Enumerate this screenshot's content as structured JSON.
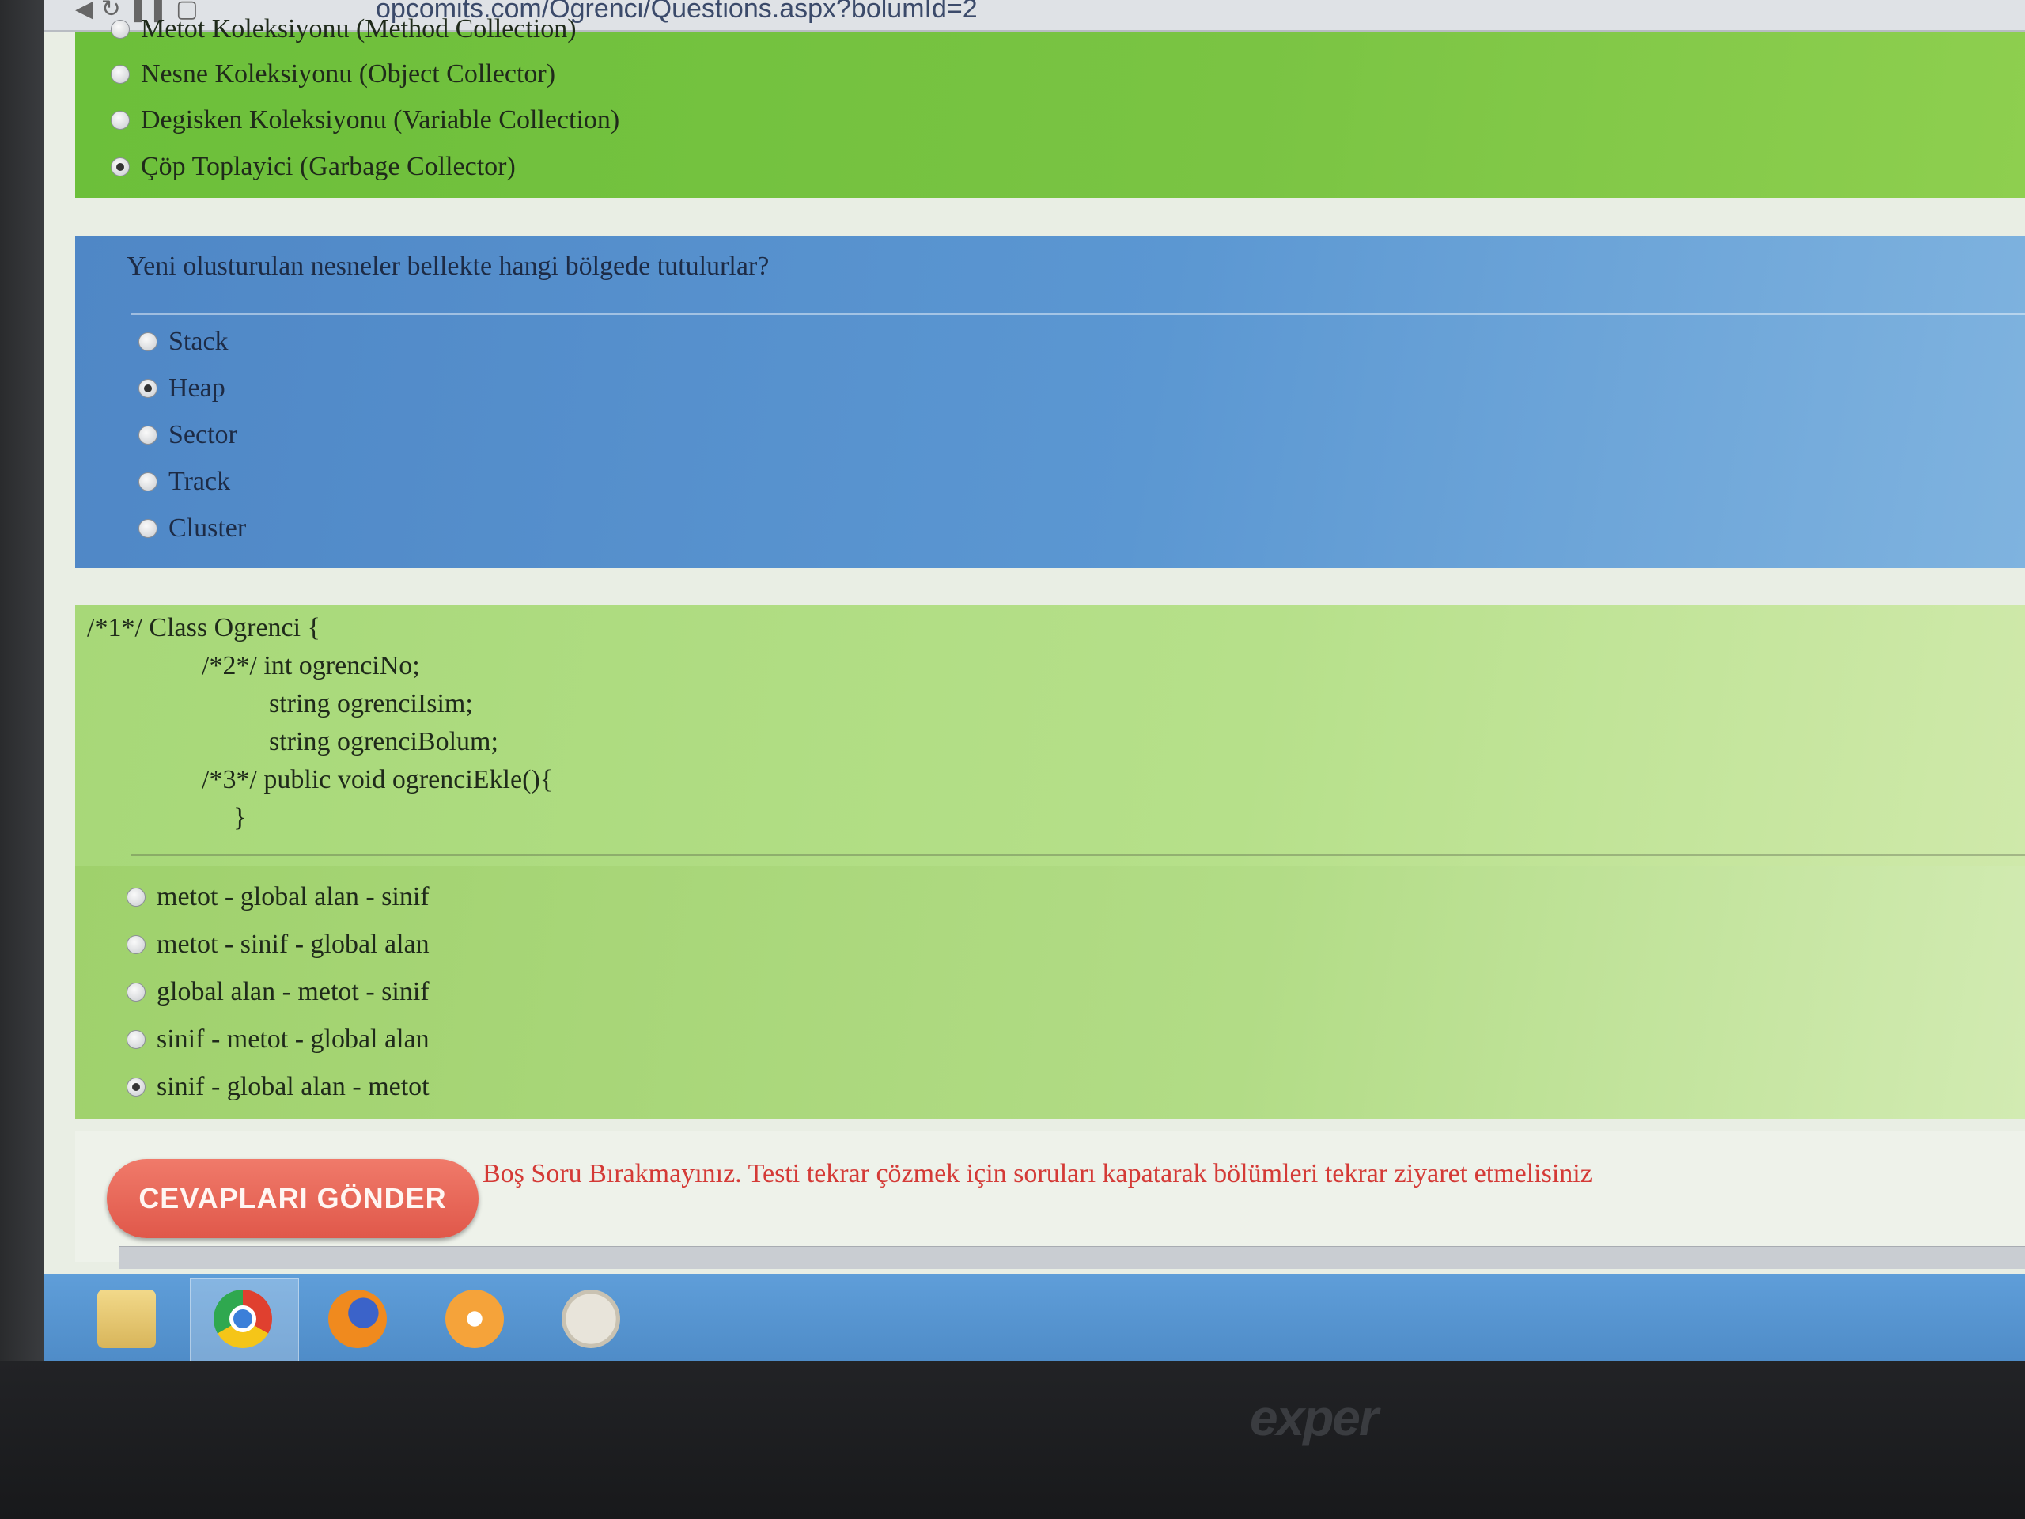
{
  "browser": {
    "url": "opcomits.com/Ogrenci/Questions.aspx?bolumId=2"
  },
  "question1": {
    "options": [
      {
        "label": "Metot Koleksiyonu (Method Collection)",
        "checked": false
      },
      {
        "label": "Nesne Koleksiyonu (Object Collector)",
        "checked": false
      },
      {
        "label": "Degisken Koleksiyonu (Variable Collection)",
        "checked": false
      },
      {
        "label": "Çöp Toplayici (Garbage Collector)",
        "checked": true
      }
    ]
  },
  "question2": {
    "text": "Yeni olusturulan nesneler bellekte hangi bölgede tutulurlar?",
    "options": [
      {
        "label": "Stack",
        "checked": false
      },
      {
        "label": "Heap",
        "checked": true
      },
      {
        "label": "Sector",
        "checked": false
      },
      {
        "label": "Track",
        "checked": false
      },
      {
        "label": "Cluster",
        "checked": false
      }
    ]
  },
  "question3": {
    "code": [
      "/*1*/ Class Ogrenci {",
      "/*2*/ int ogrenciNo;",
      "string ogrenciIsim;",
      "string ogrenciBolum;",
      "/*3*/ public void ogrenciEkle(){",
      "}"
    ],
    "options": [
      {
        "label": "metot - global alan - sinif",
        "checked": false
      },
      {
        "label": "metot - sinif - global alan",
        "checked": false
      },
      {
        "label": "global alan - metot - sinif",
        "checked": false
      },
      {
        "label": "sinif - metot - global alan",
        "checked": false
      },
      {
        "label": "sinif - global alan - metot",
        "checked": true
      }
    ]
  },
  "footer": {
    "submit_label": "CEVAPLARI GÖNDER",
    "warning": "Boş Soru Bırakmayınız. Testi tekrar çözmek için soruları kapatarak bölümleri tekrar ziyaret etmelisiniz"
  },
  "monitor": {
    "brand": "exper"
  },
  "taskbar": {
    "icons": [
      "folder-icon",
      "chrome-icon",
      "firefox-icon",
      "media-player-icon",
      "paint-icon"
    ]
  },
  "colors": {
    "green_panel": "#7ac443",
    "blue_panel": "#5b97d2",
    "submit_button": "#e0584a",
    "warning_text": "#d43a36",
    "taskbar": "#5f9ed9"
  }
}
